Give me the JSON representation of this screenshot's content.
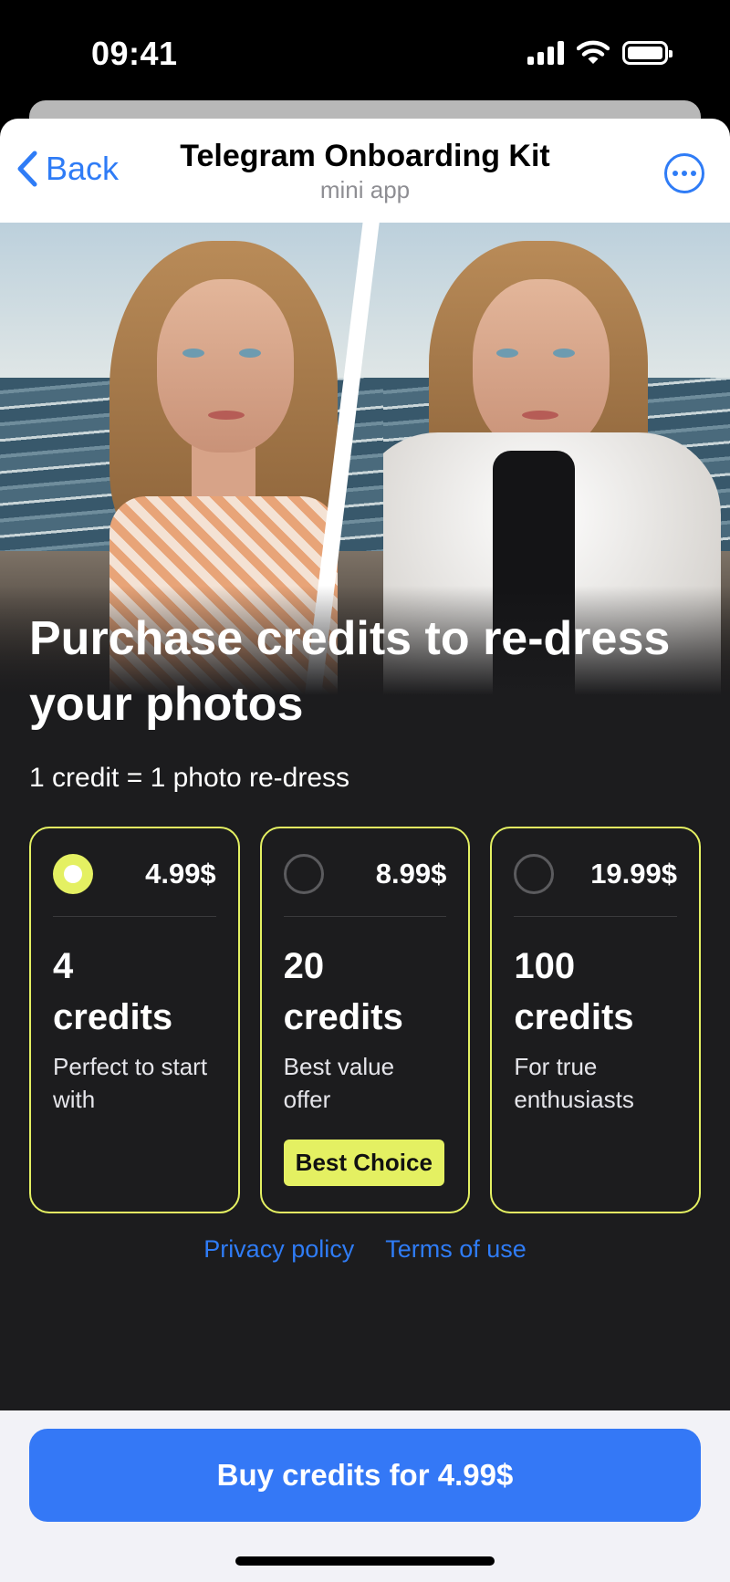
{
  "status_bar": {
    "time": "09:41",
    "icons": [
      "signal-icon",
      "wifi-icon",
      "battery-icon"
    ]
  },
  "header": {
    "back_label": "Back",
    "title": "Telegram Onboarding Kit",
    "subtitle": "mini app",
    "more_icon": "ellipsis-circle-icon"
  },
  "hero": {
    "image": "before-after-photo"
  },
  "main": {
    "heading": "Purchase credits to re-dress your photos",
    "rate": "1 credit = 1 photo re-dress"
  },
  "plans": [
    {
      "price": "4.99$",
      "amount": "4",
      "unit": "credits",
      "description": "Perfect to start with",
      "selected": true,
      "badge": ""
    },
    {
      "price": "8.99$",
      "amount": "20",
      "unit": "credits",
      "description": "Best value offer",
      "selected": false,
      "badge": "Best Choice"
    },
    {
      "price": "19.99$",
      "amount": "100",
      "unit": "credits",
      "description": "For true enthusiasts",
      "selected": false,
      "badge": ""
    }
  ],
  "links": {
    "privacy": "Privacy policy",
    "terms": "Terms of use"
  },
  "footer": {
    "buy_label": "Buy credits for 4.99$"
  },
  "colors": {
    "accent": "#2f7cf6",
    "highlight": "#e4f062",
    "background": "#1c1c1e",
    "button": "#3478f6"
  }
}
